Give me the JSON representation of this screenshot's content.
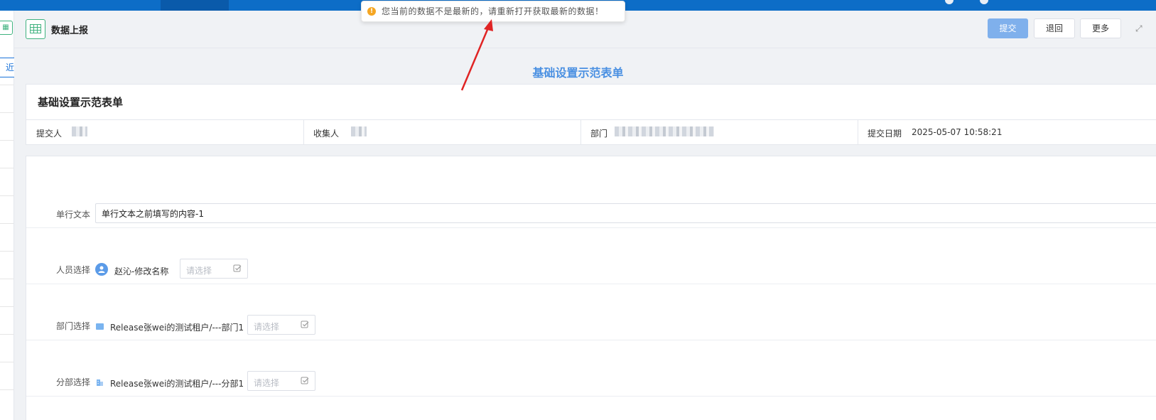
{
  "sidebar": {
    "tab_label": "近"
  },
  "header": {
    "title": "数据上报",
    "submit_label": "提交",
    "back_label": "退回",
    "more_label": "更多"
  },
  "toast": {
    "message": "您当前的数据不是最新的，请重新打开获取最新的数据！"
  },
  "form": {
    "center_title": "基础设置示范表单",
    "card_title": "基础设置示范表单",
    "meta": {
      "submitter_label": "提交人",
      "collector_label": "收集人",
      "department_label": "部门",
      "date_label": "提交日期",
      "date_value": "2025-05-07 10:58:21"
    },
    "fields": {
      "single_text": {
        "label": "单行文本",
        "value": "单行文本之前填写的内容-1"
      },
      "person": {
        "label": "人员选择",
        "selected": "赵沁-修改名称",
        "placeholder": "请选择"
      },
      "department": {
        "label": "部门选择",
        "selected": "Release张wei的测试租户/---部门1",
        "placeholder": "请选择"
      },
      "branch": {
        "label": "分部选择",
        "selected": "Release张wei的测试租户/---分部1",
        "placeholder": "请选择"
      }
    }
  },
  "colors": {
    "topbar": "#0d6dc7",
    "accent": "#4a90e2",
    "submit_button": "#7fb0ec",
    "warning": "#f5a623",
    "annotation_arrow": "#e02424"
  }
}
